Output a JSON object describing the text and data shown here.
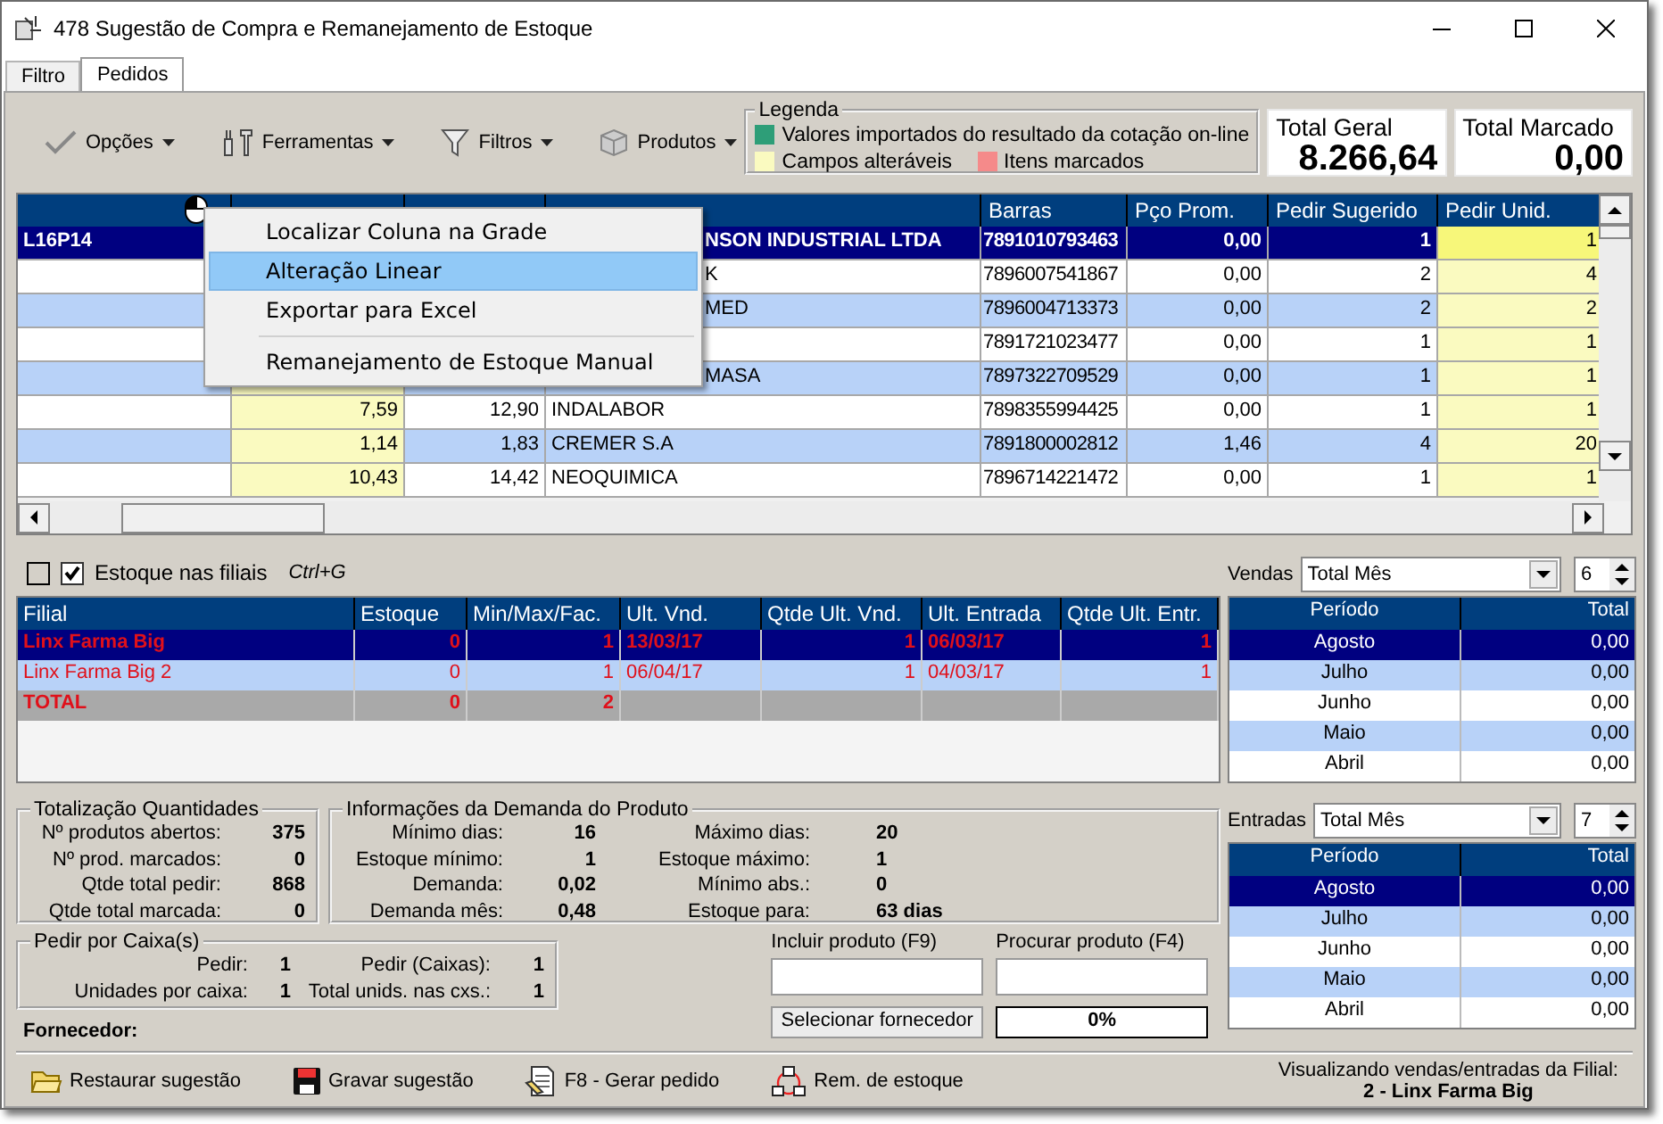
{
  "window": {
    "title": "478 Sugestão de Compra e Remanejamento de Estoque"
  },
  "tabs": [
    {
      "label": "Filtro",
      "selected": false
    },
    {
      "label": "Pedidos",
      "selected": true
    }
  ],
  "toolbar": [
    {
      "label": "Opções",
      "kind": "check"
    },
    {
      "label": "Ferramentas",
      "kind": "tools"
    },
    {
      "label": "Filtros",
      "kind": "funnel"
    },
    {
      "label": "Produtos",
      "kind": "box"
    }
  ],
  "legend": {
    "title": "Legenda",
    "items": [
      {
        "label": "Valores importados do resultado da cotação on-line",
        "color": "#2e9e78"
      },
      {
        "label": "Campos alteráveis",
        "color": "#fafac0"
      },
      {
        "label": "Itens marcados",
        "color": "#f58a8a"
      }
    ]
  },
  "totals": [
    {
      "label": "Total Geral",
      "value": "8.266,64"
    },
    {
      "label": "Total Marcado",
      "value": "0,00"
    }
  ],
  "grid": {
    "columns": [
      {
        "kind": "icon"
      },
      {
        "kind": "covered"
      },
      {
        "kind": "covered"
      },
      {
        "kind": "covered"
      },
      {
        "kind": "text",
        "label": "Barras"
      },
      {
        "kind": "text",
        "label": "Pço Prom."
      },
      {
        "kind": "text",
        "label": "Pedir Sugerido"
      },
      {
        "kind": "text",
        "label": "Pedir Unid."
      }
    ],
    "rows": [
      {
        "selected": true,
        "cells": [
          "L16P14",
          null,
          null,
          "NSON INDUSTRIAL LTDA",
          "7891010793463",
          "0,00",
          "1",
          "1"
        ]
      },
      {
        "selected": false,
        "cells": [
          null,
          null,
          null,
          "K",
          "7896007541867",
          "0,00",
          "2",
          "4"
        ]
      },
      {
        "selected": false,
        "cells": [
          null,
          null,
          null,
          "MED",
          "7896004713373",
          "0,00",
          "2",
          "2"
        ]
      },
      {
        "selected": false,
        "cells": [
          null,
          null,
          null,
          null,
          "7891721023477",
          "0,00",
          "1",
          "1"
        ]
      },
      {
        "selected": false,
        "cells": [
          null,
          null,
          null,
          "MASA",
          "7897322709529",
          "0,00",
          "1",
          "1"
        ]
      },
      {
        "selected": false,
        "cells": [
          null,
          "7,59",
          "12,90",
          "INDALABOR",
          "7898355994425",
          "0,00",
          "1",
          "1"
        ]
      },
      {
        "selected": false,
        "cells": [
          null,
          "1,14",
          "1,83",
          "CREMER S.A",
          "7891800002812",
          "1,46",
          "4",
          "20"
        ]
      },
      {
        "selected": false,
        "cells": [
          null,
          "10,43",
          "14,42",
          "NEOQUIMICA",
          "7896714221472",
          "0,00",
          "1",
          "1"
        ]
      }
    ]
  },
  "context_menu": {
    "items": [
      {
        "kind": "item",
        "label": "Localizar Coluna na Grade",
        "selected": false
      },
      {
        "kind": "item",
        "label": "Alteração Linear",
        "selected": true
      },
      {
        "kind": "item",
        "label": "Exportar para Excel",
        "selected": false
      },
      {
        "kind": "separator"
      },
      {
        "kind": "item",
        "label": "Remanejamento de Estoque Manual",
        "selected": false
      }
    ]
  },
  "options": [
    {
      "checked": false
    },
    {
      "checked": true,
      "label": "Estoque nas filiais",
      "shortcut": "Ctrl+G"
    }
  ],
  "filiais": {
    "columns": [
      "Filial",
      "Estoque",
      "Min/Max/Fac.",
      "Ult. Vnd.",
      "Qtde Ult. Vnd.",
      "Ult. Entrada",
      "Qtde Ult. Entr."
    ],
    "rows": [
      {
        "kind": "branch",
        "selected": true,
        "cells": [
          "Linx Farma Big",
          "0",
          "1",
          "13/03/17",
          "1",
          "06/03/17",
          "1"
        ]
      },
      {
        "kind": "branch",
        "selected": false,
        "cells": [
          "Linx Farma Big 2",
          "0",
          "1",
          "06/04/17",
          "1",
          "04/03/17",
          "1"
        ]
      },
      {
        "kind": "total",
        "selected": false,
        "cells": [
          "TOTAL",
          "0",
          "2",
          null,
          null,
          null,
          null
        ]
      }
    ]
  },
  "vendas": {
    "label": "Vendas",
    "mode": "Total Mês",
    "count": "6",
    "columns": [
      "Período",
      "Total"
    ],
    "rows": [
      {
        "period": "Agosto",
        "total": "0,00",
        "selected": true
      },
      {
        "period": "Julho",
        "total": "0,00",
        "selected": false
      },
      {
        "period": "Junho",
        "total": "0,00",
        "selected": false
      },
      {
        "period": "Maio",
        "total": "0,00",
        "selected": false
      },
      {
        "period": "Abril",
        "total": "0,00",
        "selected": false
      }
    ]
  },
  "totalizacao": {
    "title": "Totalização Quantidades",
    "rows": [
      {
        "label": "Nº produtos abertos:",
        "value": "375"
      },
      {
        "label": "Nº prod. marcados:",
        "value": "0"
      },
      {
        "label": "Qtde total pedir:",
        "value": "868"
      },
      {
        "label": "Qtde total marcada:",
        "value": "0"
      }
    ]
  },
  "demanda": {
    "title": "Informações da Demanda do Produto",
    "rows": [
      {
        "label": "Mínimo dias:",
        "value": "16",
        "label2": "Máximo dias:",
        "value2": "20"
      },
      {
        "label": "Estoque mínimo:",
        "value": "1",
        "label2": "Estoque máximo:",
        "value2": "1"
      },
      {
        "label": "Demanda:",
        "value": "0,02",
        "label2": "Mínimo abs.:",
        "value2": "0"
      },
      {
        "label": "Demanda mês:",
        "value": "0,48",
        "label2": "Estoque para:",
        "value2": "63",
        "unit": "dias"
      }
    ]
  },
  "entradas": {
    "label": "Entradas",
    "mode": "Total Mês",
    "count": "7",
    "columns": [
      "Período",
      "Total"
    ],
    "rows": [
      {
        "period": "Agosto",
        "total": "0,00",
        "selected": true
      },
      {
        "period": "Julho",
        "total": "0,00",
        "selected": false
      },
      {
        "period": "Junho",
        "total": "0,00",
        "selected": false
      },
      {
        "period": "Maio",
        "total": "0,00",
        "selected": false
      },
      {
        "period": "Abril",
        "total": "0,00",
        "selected": false
      }
    ]
  },
  "caixas": {
    "title": "Pedir por Caixa(s)",
    "items": [
      {
        "label": "Pedir:",
        "value": "1"
      },
      {
        "label": "Pedir (Caixas):",
        "value": "1"
      },
      {
        "label": "Unidades por caixa:",
        "value": "1"
      },
      {
        "label": "Total unids. nas cxs.:",
        "value": "1"
      }
    ]
  },
  "fornecedor": {
    "label": "Fornecedor:"
  },
  "incluir": {
    "label": "Incluir produto (F9)"
  },
  "procurar": {
    "label": "Procurar produto (F4)"
  },
  "select_button": {
    "label": "Selecionar fornecedor"
  },
  "progress": {
    "level": 0,
    "text": "0%"
  },
  "actions": [
    {
      "label": "Restaurar sugestão",
      "kind": "folder"
    },
    {
      "label": "Gravar sugestão",
      "kind": "floppy"
    },
    {
      "label": "F8 - Gerar pedido",
      "kind": "document"
    },
    {
      "label": "Rem. de estoque",
      "kind": "network"
    }
  ],
  "status": {
    "line1": "Visualizando vendas/entradas da Filial:",
    "line2": "2 - Linx Farma Big"
  }
}
